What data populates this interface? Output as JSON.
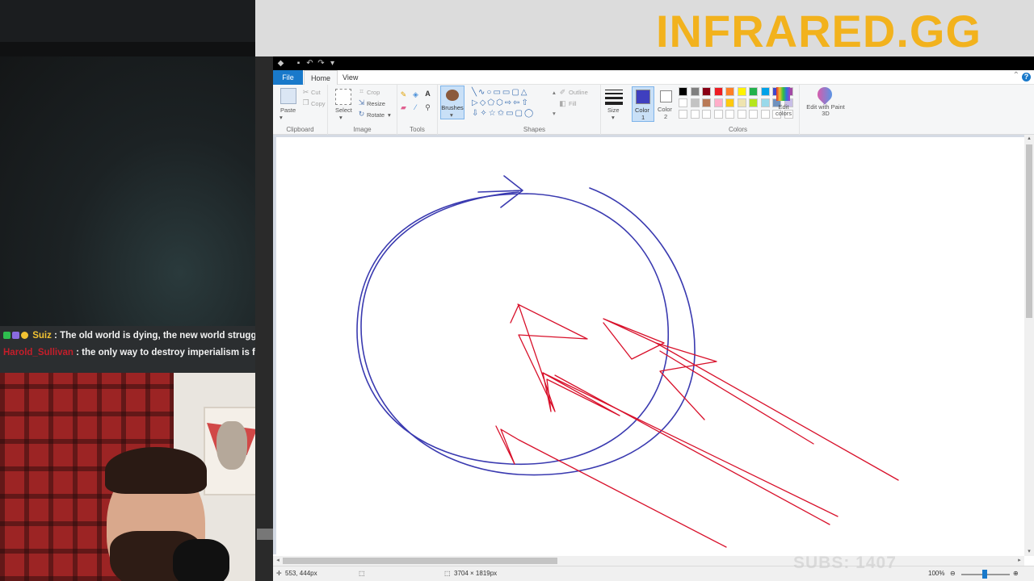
{
  "overlay": {
    "logo_text": "INFRARED.GG",
    "subs_text": "SUBS: 1407",
    "logo_color": "#f2b21d"
  },
  "chat": {
    "messages": [
      {
        "user": "Suiz",
        "text": " : The old world is dying, the new world struggles to",
        "user_color": "#f1c232"
      },
      {
        "user": "Harold_Sullivan",
        "text": " : the only way to destroy imperialism is from w",
        "user_color": "#c41e2a"
      }
    ]
  },
  "paint": {
    "menu": {
      "file": "File",
      "home": "Home",
      "view": "View",
      "help": "?"
    },
    "clipboard": {
      "paste": "Paste",
      "cut": "Cut",
      "copy": "Copy",
      "label": "Clipboard"
    },
    "image": {
      "select": "Select",
      "crop": "Crop",
      "resize": "Resize",
      "rotate": "Rotate",
      "label": "Image"
    },
    "tools": {
      "label": "Tools",
      "text_tool": "A"
    },
    "brushes": {
      "label": "Brushes"
    },
    "shapes": {
      "outline": "Outline",
      "fill": "Fill",
      "label": "Shapes"
    },
    "size": {
      "label": "Size"
    },
    "color1": {
      "label": "Color",
      "index": "1",
      "value": "#3f3fbf"
    },
    "color2": {
      "label": "Color",
      "index": "2",
      "value": "#ffffff"
    },
    "colors": {
      "label": "Colors",
      "row1": [
        "#000000",
        "#7f7f7f",
        "#880015",
        "#ed1c24",
        "#ff7f27",
        "#fff200",
        "#22b14c",
        "#00a2e8",
        "#3f48cc",
        "#a349a4"
      ],
      "row2": [
        "#ffffff",
        "#c3c3c3",
        "#b97a57",
        "#ffaec9",
        "#ffc90e",
        "#efe4b0",
        "#b5e61d",
        "#99d9ea",
        "#7092be",
        "#c8bfe7"
      ],
      "edit": "Edit colors"
    },
    "paint3d": {
      "label": "Edit with Paint 3D"
    },
    "status": {
      "cursor_pos": "553, 444px",
      "image_size": "3704 × 1819px",
      "zoom": "100%"
    },
    "stroke_colors": {
      "blue": "#3a3ab0",
      "red": "#d8102a"
    }
  }
}
